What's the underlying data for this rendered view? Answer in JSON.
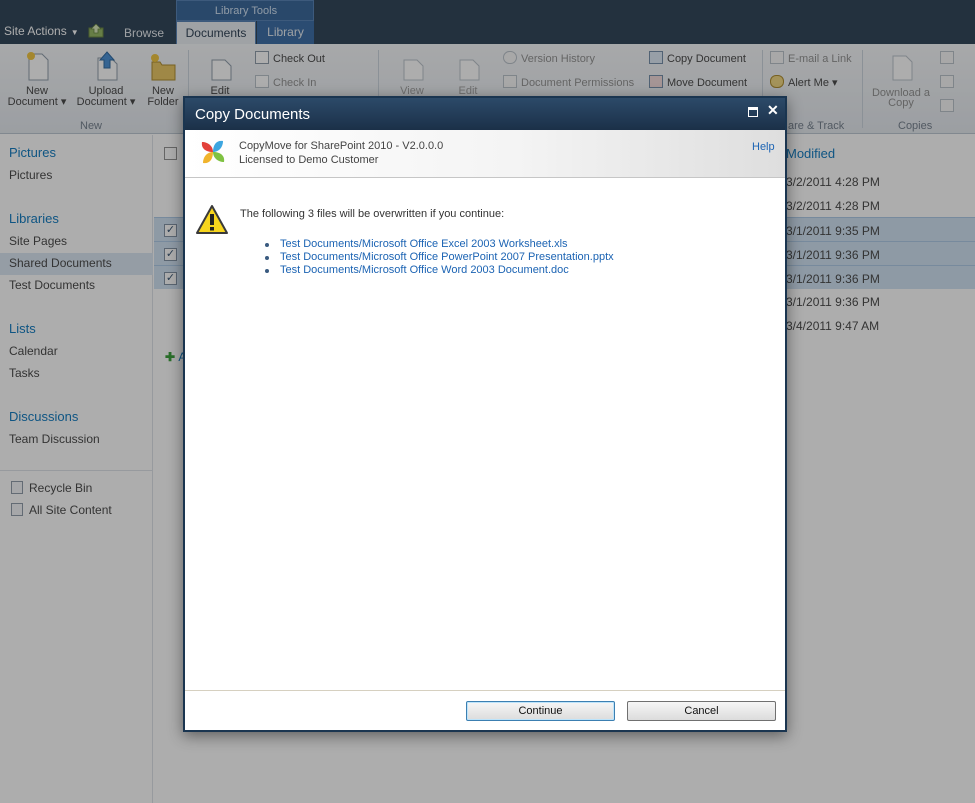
{
  "topbar": {
    "site_actions": "Site Actions",
    "tab_browse": "Browse",
    "tab_group_label": "Library Tools",
    "tab_documents": "Documents",
    "tab_library": "Library"
  },
  "ribbon": {
    "new_document": [
      "New",
      "Document"
    ],
    "upload_document": [
      "Upload",
      "Document"
    ],
    "new_folder": [
      "New",
      "Folder"
    ],
    "group_new": "New",
    "edit_document": "Edit",
    "check_out": "Check Out",
    "check_in": "Check In",
    "view_properties": "View",
    "edit_properties": "Edit",
    "version_history": "Version History",
    "document_permissions": "Document Permissions",
    "copy_document": "Copy Document",
    "move_document": "Move Document",
    "email_link": "E-mail a Link",
    "alert_me": "Alert Me",
    "group_share_track": "are & Track",
    "download_copy": [
      "Download a",
      "Copy"
    ],
    "group_copies": "Copies"
  },
  "leftnav": {
    "pictures_head": "Pictures",
    "pictures_item": "Pictures",
    "libraries_head": "Libraries",
    "site_pages": "Site Pages",
    "shared_documents": "Shared Documents",
    "test_documents": "Test Documents",
    "lists_head": "Lists",
    "calendar": "Calendar",
    "tasks": "Tasks",
    "discussions_head": "Discussions",
    "team_discussion": "Team Discussion",
    "recycle_bin": "Recycle Bin",
    "all_site_content": "All Site Content"
  },
  "doclist": {
    "modified_header": "Modified",
    "add_document_label": "A",
    "rows": [
      {
        "modified": "3/2/2011 4:28 PM",
        "selected": false
      },
      {
        "modified": "3/2/2011 4:28 PM",
        "selected": false
      },
      {
        "modified": "3/1/2011 9:35 PM",
        "selected": true
      },
      {
        "modified": "3/1/2011 9:36 PM",
        "selected": true
      },
      {
        "modified": "3/1/2011 9:36 PM",
        "selected": true
      },
      {
        "modified": "3/1/2011 9:36 PM",
        "selected": false
      },
      {
        "modified": "3/4/2011 9:47 AM",
        "selected": false
      }
    ]
  },
  "dialog": {
    "title": "Copy Documents",
    "product_name": "CopyMove for SharePoint 2010 - V2.0.0.0",
    "license": "Licensed to Demo Customer",
    "help": "Help",
    "warning_message": "The following 3 files will be overwritten if you continue:",
    "files": [
      "Test Documents/Microsoft Office Excel 2003 Worksheet.xls",
      "Test Documents/Microsoft Office PowerPoint 2007 Presentation.pptx",
      "Test Documents/Microsoft Office Word 2003 Document.doc"
    ],
    "continue_label": "Continue",
    "cancel_label": "Cancel"
  },
  "colors": {
    "topbar": "#21374c",
    "dialog_titlebar": "#1b3048",
    "link_blue": "#1b63b3",
    "selected_row": "#cde0f3"
  }
}
